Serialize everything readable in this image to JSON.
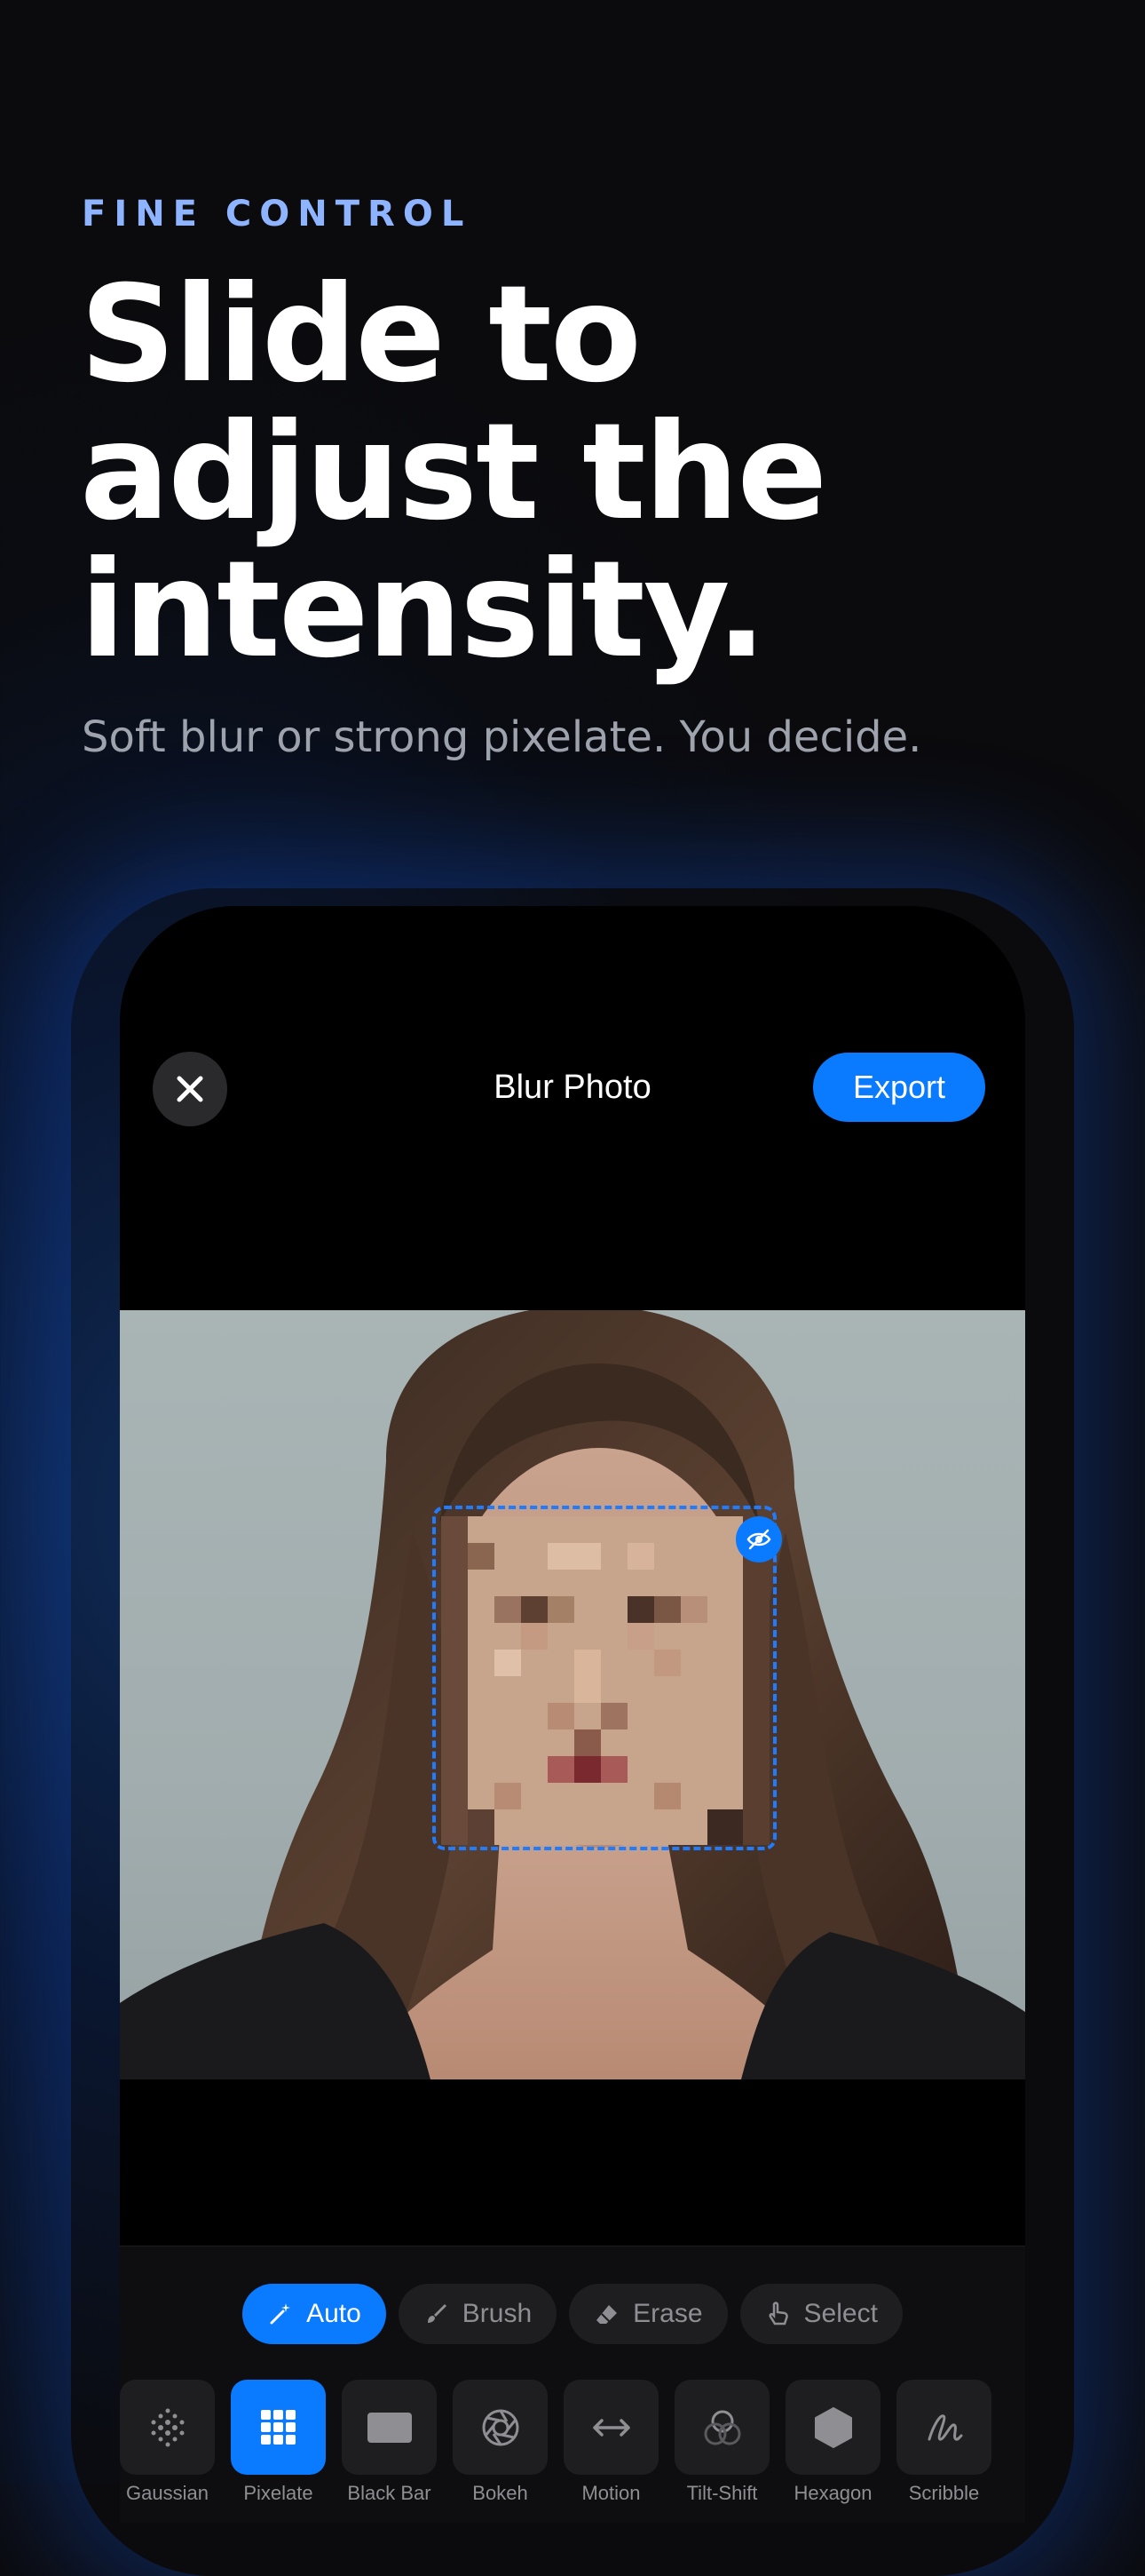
{
  "hero": {
    "eyebrow": "FINE CONTROL",
    "headline": "Slide to adjust the intensity.",
    "subhead": "Soft blur or strong pixelate. You decide."
  },
  "nav": {
    "title": "Blur Photo",
    "export_label": "Export"
  },
  "modes": [
    {
      "label": "Auto",
      "icon": "magic-wand-icon",
      "active": true
    },
    {
      "label": "Brush",
      "icon": "brush-icon",
      "active": false
    },
    {
      "label": "Erase",
      "icon": "eraser-icon",
      "active": false
    },
    {
      "label": "Select",
      "icon": "hand-pointer-icon",
      "active": false
    }
  ],
  "effects": [
    {
      "label": "Gaussian",
      "icon": "dot-grid-icon",
      "active": false
    },
    {
      "label": "Pixelate",
      "icon": "pixel-grid-icon",
      "active": true
    },
    {
      "label": "Black Bar",
      "icon": "rectangle-icon",
      "active": false
    },
    {
      "label": "Bokeh",
      "icon": "aperture-icon",
      "active": false
    },
    {
      "label": "Motion",
      "icon": "arrows-horizontal-icon",
      "active": false
    },
    {
      "label": "Tilt-Shift",
      "icon": "overlap-circles-icon",
      "active": false
    },
    {
      "label": "Hexagon",
      "icon": "hexagon-icon",
      "active": false
    },
    {
      "label": "Scribble",
      "icon": "scribble-icon",
      "active": false
    }
  ],
  "colors": {
    "accent": "#0a7aff",
    "eyebrow": "#8fb4ff"
  }
}
